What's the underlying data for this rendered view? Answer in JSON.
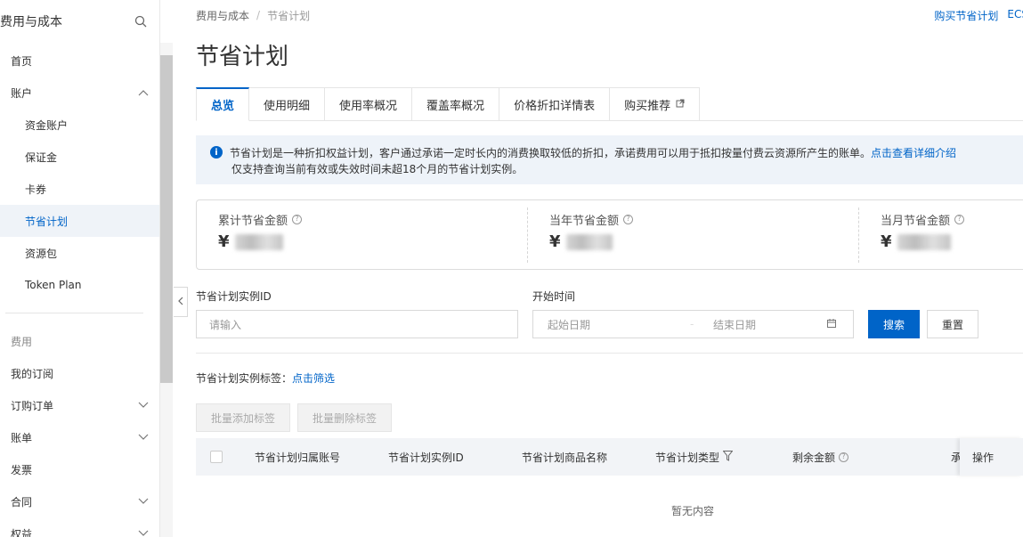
{
  "sidebar": {
    "title": "费用与成本",
    "items": [
      {
        "label": "首页"
      },
      {
        "label": "账户"
      },
      {
        "label": "资金账户"
      },
      {
        "label": "保证金"
      },
      {
        "label": "卡券"
      },
      {
        "label": "节省计划"
      },
      {
        "label": "资源包"
      },
      {
        "label": "Token Plan"
      },
      {
        "label": "费用"
      },
      {
        "label": "我的订阅"
      },
      {
        "label": "订购订单"
      },
      {
        "label": "账单"
      },
      {
        "label": "发票"
      },
      {
        "label": "合同"
      },
      {
        "label": "权益"
      }
    ]
  },
  "breadcrumb": {
    "parent": "费用与成本",
    "sep": "/",
    "current": "节省计划"
  },
  "top_links": {
    "buy": "购买节省计划",
    "ecs": "ECS"
  },
  "page_title": "节省计划",
  "tabs": [
    "总览",
    "使用明细",
    "使用率概况",
    "覆盖率概况",
    "价格折扣详情表",
    "购买推荐"
  ],
  "notice": {
    "line1": "节省计划是一种折扣权益计划，客户通过承诺一定时长内的消费换取较低的折扣，承诺费用可以用于抵扣按量付费云资源所产生的账单。",
    "link": "点击查看详细介绍",
    "line2": "仅支持查询当前有效或失效时间未超18个月的节省计划实例。"
  },
  "stats": [
    {
      "label": "累计节省金额",
      "currency": "¥"
    },
    {
      "label": "当年节省金额",
      "currency": "¥"
    },
    {
      "label": "当月节省金额",
      "currency": "¥"
    }
  ],
  "filters": {
    "id_label": "节省计划实例ID",
    "id_placeholder": "请输入",
    "time_label": "开始时间",
    "start_placeholder": "起始日期",
    "range_sep": "-",
    "end_placeholder": "结束日期",
    "search": "搜索",
    "reset": "重置"
  },
  "tag_filter": {
    "label": "节省计划实例标签：",
    "link": "点击筛选"
  },
  "bulk": {
    "add": "批量添加标签",
    "remove": "批量删除标签"
  },
  "table": {
    "columns": [
      "节省计划归属账号",
      "节省计划实例ID",
      "节省计划商品名称",
      "节省计划类型",
      "剩余金额",
      "承",
      "操作"
    ],
    "empty": "暂无内容"
  }
}
